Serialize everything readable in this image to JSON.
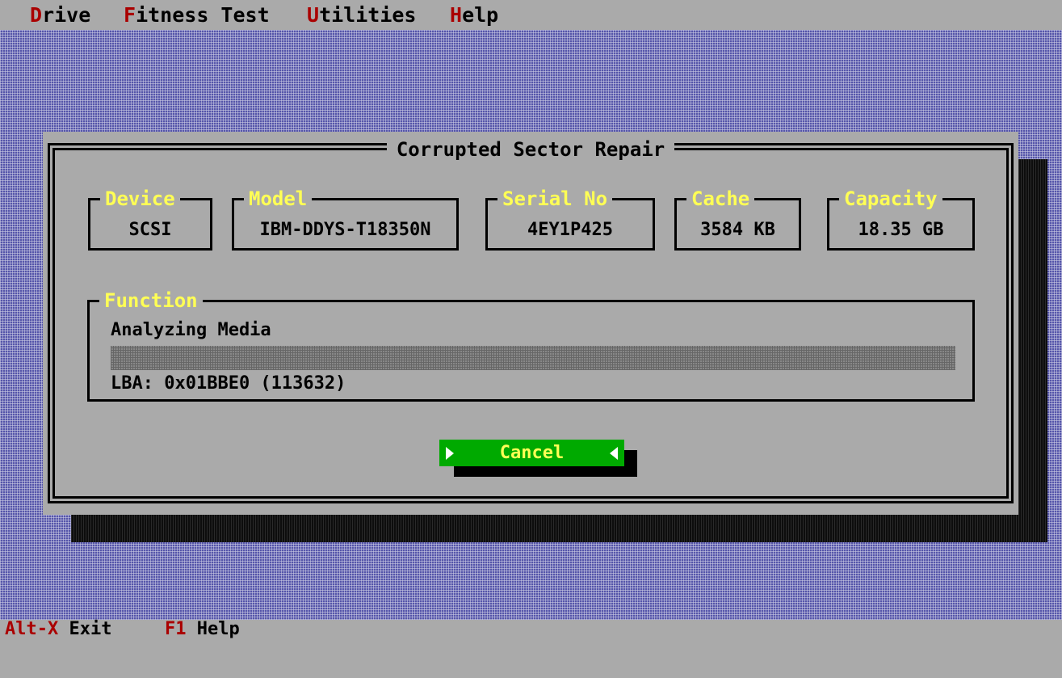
{
  "menu": {
    "items": [
      {
        "hot": "D",
        "rest": "rive"
      },
      {
        "hot": "F",
        "rest": "itness Test"
      },
      {
        "hot": "U",
        "rest": "tilities"
      },
      {
        "hot": "H",
        "rest": "elp"
      }
    ]
  },
  "dialog": {
    "title": "Corrupted Sector Repair",
    "fields": [
      {
        "label": "Device",
        "value": "SCSI"
      },
      {
        "label": "Model",
        "value": "IBM-DDYS-T18350N"
      },
      {
        "label": "Serial No",
        "value": "4EY1P425"
      },
      {
        "label": "Cache",
        "value": "3584 KB"
      },
      {
        "label": "Capacity",
        "value": "18.35 GB"
      }
    ],
    "function": {
      "label": "Function",
      "status": "Analyzing Media",
      "lba": "LBA: 0x01BBE0 (113632)"
    },
    "cancel_label": "Cancel"
  },
  "statusbar": {
    "items": [
      {
        "key": "Alt-X",
        "label": "Exit"
      },
      {
        "key": "F1",
        "label": "Help"
      }
    ]
  },
  "colors": {
    "desktop": "#5555aa",
    "hotkey": "#aa0000",
    "label": "#ffff55",
    "button": "#00aa00"
  }
}
